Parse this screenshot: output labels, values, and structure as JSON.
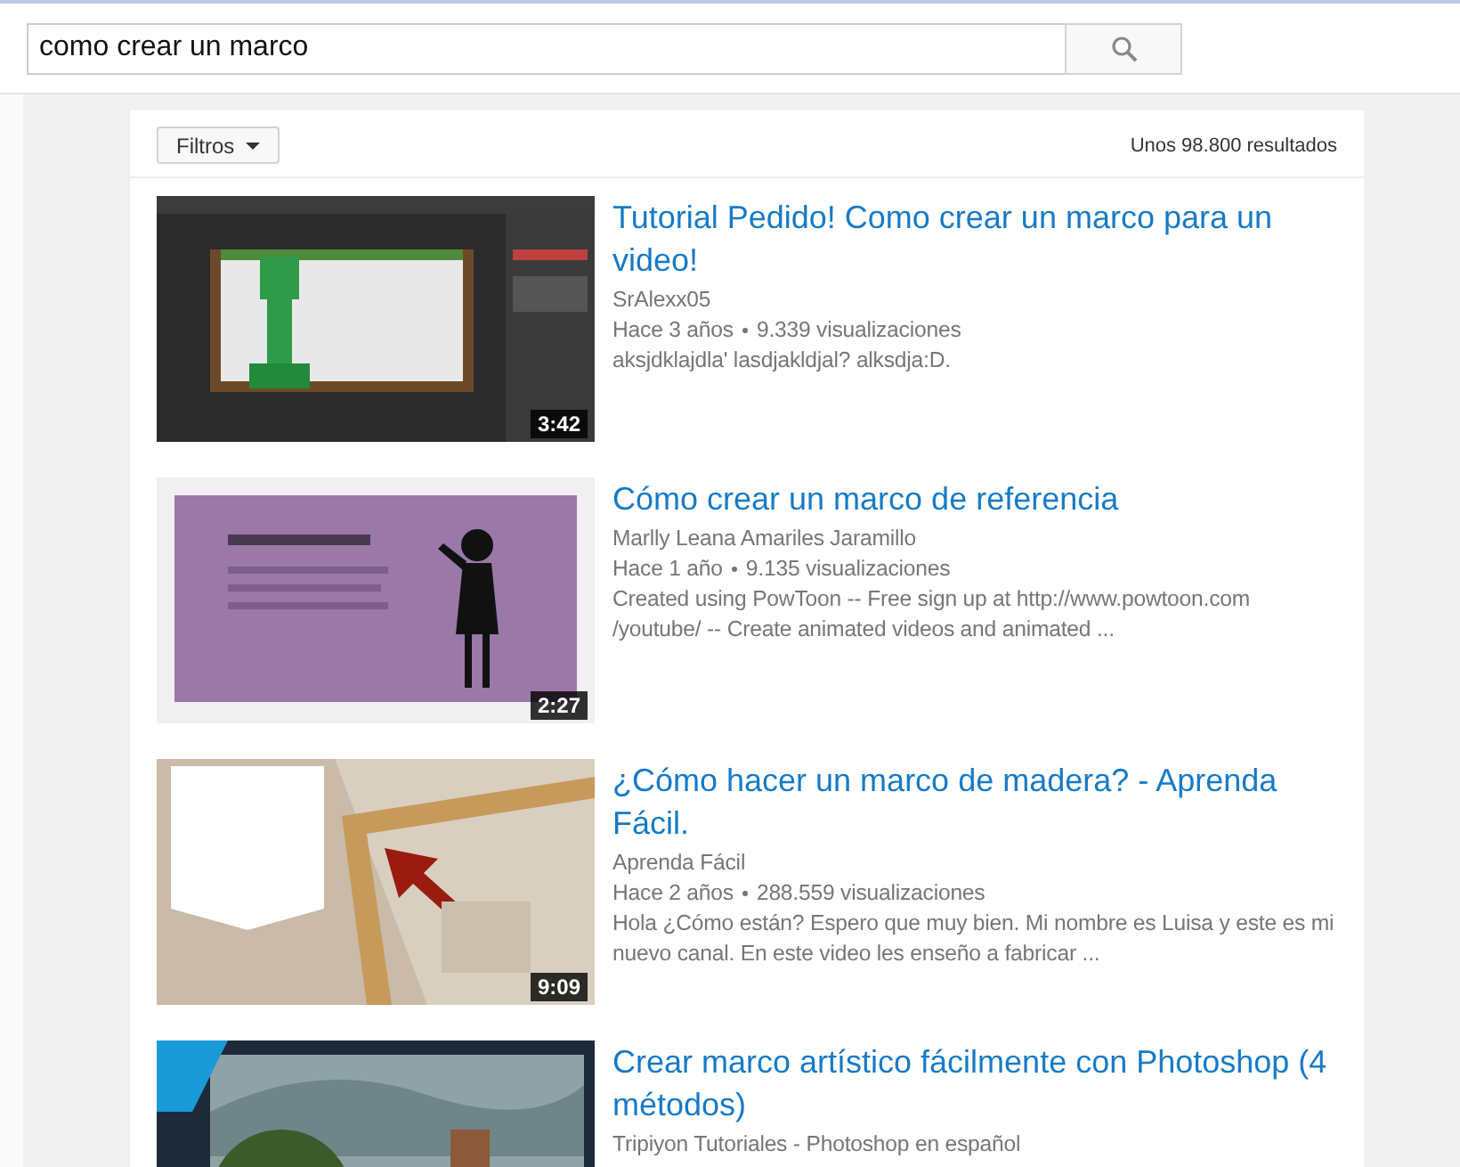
{
  "search": {
    "value": "como crear un marco"
  },
  "filters": {
    "label": "Filtros",
    "result_count": "Unos 98.800 resultados"
  },
  "results": [
    {
      "duration": "3:42",
      "title": "Tutorial Pedido! Como crear un marco para un video!",
      "channel": "SrAlexx05",
      "age": "Hace 3 años",
      "views": "9.339 visualizaciones",
      "description": "aksjdklajdla' lasdjakldjal? alksdja:D."
    },
    {
      "duration": "2:27",
      "title": "Cómo crear un marco de referencia",
      "channel": "Marlly Leana Amariles Jaramillo",
      "age": "Hace 1 año",
      "views": "9.135 visualizaciones",
      "description": "Created using PowToon -- Free sign up at http://www.powtoon.com /youtube/ -- Create animated videos and animated ..."
    },
    {
      "duration": "9:09",
      "title": "¿Cómo hacer un marco de madera? - Aprenda Fácil.",
      "channel": "Aprenda Fácil",
      "age": "Hace 2 años",
      "views": "288.559 visualizaciones",
      "description": "Hola ¿Cómo están? Espero que muy bien. Mi nombre es Luisa y este es mi nuevo canal. En este video les enseño a fabricar ..."
    },
    {
      "title": "Crear marco artístico fácilmente con Photoshop (4 métodos)",
      "channel": "Tripiyon Tutoriales - Photoshop en español"
    }
  ]
}
